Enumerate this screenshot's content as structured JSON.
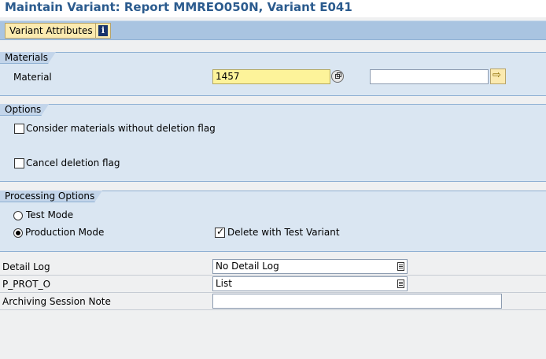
{
  "title": "Maintain Variant: Report MMREO050N, Variant E041",
  "toolbar": {
    "variant_attributes_label": "Variant Attributes",
    "info_glyph": "i"
  },
  "materials": {
    "header": "Materials",
    "material_label": "Material",
    "material_from": "1457",
    "material_to": ""
  },
  "options": {
    "header": "Options",
    "consider_label": "Consider materials without deletion flag",
    "consider_checked": false,
    "cancel_label": "Cancel deletion flag",
    "cancel_checked": false
  },
  "processing": {
    "header": "Processing Options",
    "test_mode_label": "Test Mode",
    "production_mode_label": "Production Mode",
    "selected_mode": "Production Mode",
    "delete_test_variant_label": "Delete with Test Variant",
    "delete_test_variant_checked": true
  },
  "fields": {
    "detail_log_label": "Detail Log",
    "detail_log_value": "No Detail Log",
    "p_prot_label": "P_PROT_O",
    "p_prot_value": "List",
    "archiving_note_label": "Archiving Session Note",
    "archiving_note_value": ""
  },
  "colors": {
    "title": "#2b5b8e",
    "toolbar": "#a9c4e1",
    "group_bg": "#dae6f2",
    "required_field": "#fdf39a",
    "button": "#fbeab0"
  },
  "icons": {
    "info": "info-icon",
    "multiple_selection": "multiple-selection-icon",
    "dropdown": "dropdown-icon"
  }
}
